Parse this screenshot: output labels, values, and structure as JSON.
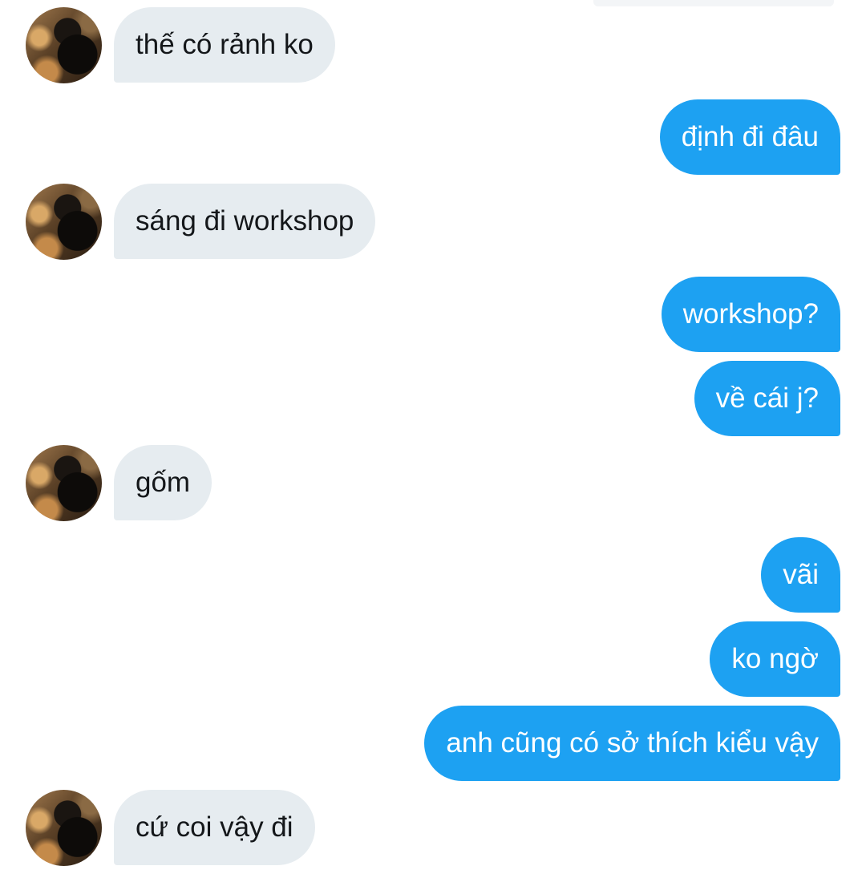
{
  "conversation": {
    "messages": [
      {
        "direction": "in",
        "text": "thế có rảnh ko"
      },
      {
        "direction": "out",
        "text": "định đi đâu"
      },
      {
        "direction": "in",
        "text": "sáng đi workshop"
      },
      {
        "direction": "out",
        "text": "workshop?"
      },
      {
        "direction": "out",
        "text": "về cái j?"
      },
      {
        "direction": "in",
        "text": "gốm"
      },
      {
        "direction": "out",
        "text": "vãi"
      },
      {
        "direction": "out",
        "text": "ko ngờ"
      },
      {
        "direction": "out",
        "text": "anh cũng có sở thích kiểu vậy"
      },
      {
        "direction": "in",
        "text": "cứ coi vậy đi"
      }
    ]
  },
  "colors": {
    "incoming_bubble": "#e6ecf0",
    "outgoing_bubble": "#1da1f2",
    "incoming_text": "#14171a",
    "outgoing_text": "#ffffff",
    "background": "#ffffff"
  },
  "icons": {
    "avatar": "contact-avatar-photo"
  }
}
